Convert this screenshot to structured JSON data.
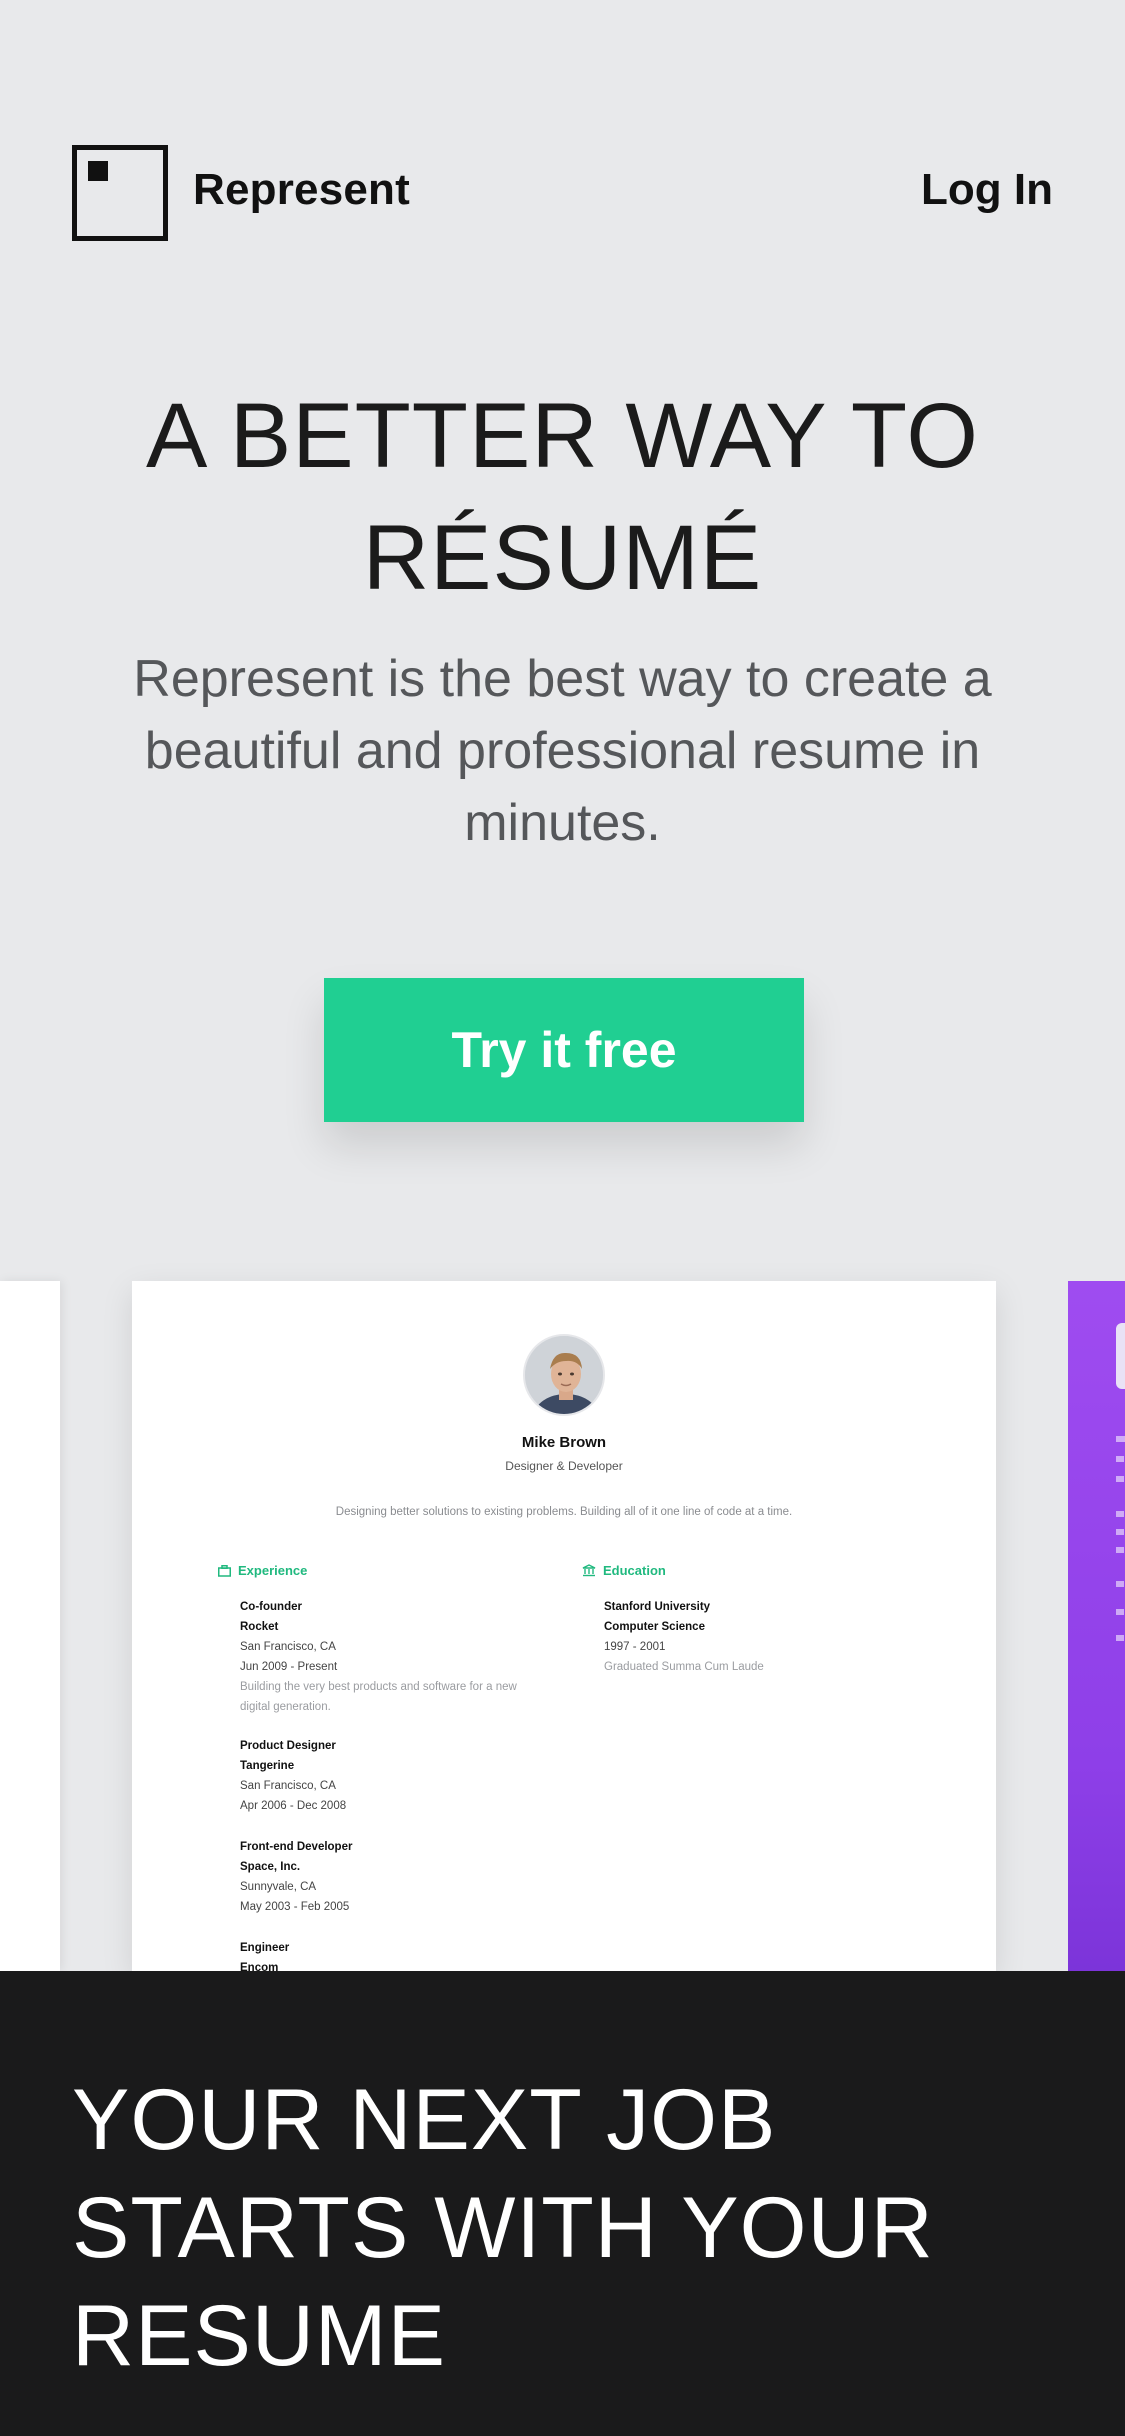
{
  "header": {
    "brand": "Represent",
    "login_label": "Log In",
    "logo_icon": "square-logo-icon"
  },
  "hero": {
    "title_line1": "A BETTER WAY TO",
    "title_line2": "RÉSUMÉ",
    "subtitle": "Represent is the best way to create a beautiful and professional resume in minutes.",
    "cta_label": "Try it free"
  },
  "resume_preview": {
    "name": "Mike Brown",
    "role": "Designer & Developer",
    "bio": "Designing better solutions to existing problems. Building all of it one line of code at a time.",
    "experience_heading": "Experience",
    "education_heading": "Education",
    "experience": [
      {
        "title": "Co-founder",
        "company": "Rocket",
        "location": "San Francisco, CA",
        "dates": "Jun 2009 - Present",
        "description_line1": "Building the very best products and software for a new",
        "description_line2": "digital generation."
      },
      {
        "title": "Product Designer",
        "company": "Tangerine",
        "location": "San Francisco, CA",
        "dates": "Apr 2006 - Dec 2008"
      },
      {
        "title": "Front-end Developer",
        "company": "Space, Inc.",
        "location": "Sunnyvale, CA",
        "dates": "May 2003 - Feb 2005"
      },
      {
        "title": "Engineer",
        "company": "Encom"
      }
    ],
    "education": {
      "school": "Stanford University",
      "field": "Computer Science",
      "dates": "1997 - 2001",
      "note": "Graduated Summa Cum Laude"
    }
  },
  "band": {
    "line1": "YOUR NEXT JOB",
    "line2": "STARTS WITH YOUR",
    "line3": "RESUME"
  },
  "colors": {
    "background": "#e8e9eb",
    "accent": "#20cf92",
    "dark_band": "#1a1a1b",
    "purple_card": "#9f4cf0"
  }
}
